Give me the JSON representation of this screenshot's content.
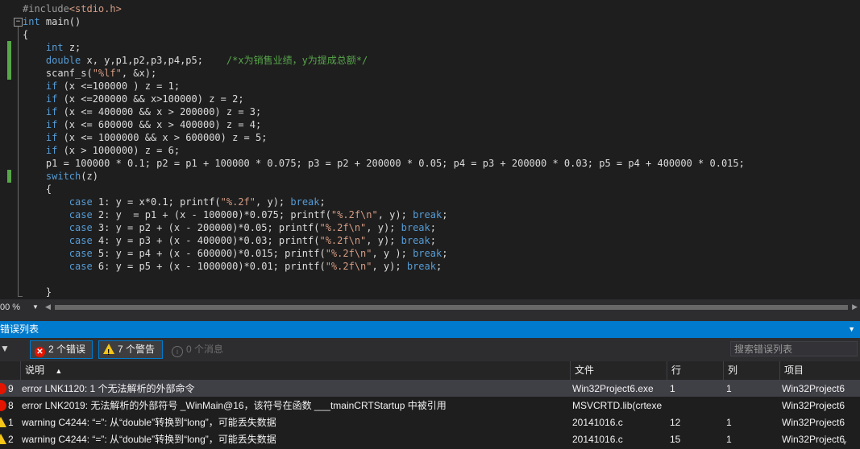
{
  "editor": {
    "lines": [
      [
        {
          "t": "#include",
          "c": "pp"
        },
        {
          "t": "<stdio.h>",
          "c": "hd"
        }
      ],
      [
        {
          "t": "int",
          "c": "kw"
        },
        {
          "t": " main()",
          "c": "tx"
        }
      ],
      [
        {
          "t": "{",
          "c": "tx"
        }
      ],
      [
        {
          "t": "    ",
          "c": "tx"
        },
        {
          "t": "int",
          "c": "kw"
        },
        {
          "t": " z;",
          "c": "tx"
        }
      ],
      [
        {
          "t": "    ",
          "c": "tx"
        },
        {
          "t": "double",
          "c": "kw"
        },
        {
          "t": " x, y,p1,p2,p3,p4,p5;    ",
          "c": "tx"
        },
        {
          "t": "/*x为销售业绩，y为提成总额*/",
          "c": "cm"
        }
      ],
      [
        {
          "t": "    scanf_s(",
          "c": "tx"
        },
        {
          "t": "\"%lf\"",
          "c": "str"
        },
        {
          "t": ", &x);",
          "c": "tx"
        }
      ],
      [
        {
          "t": "    ",
          "c": "tx"
        },
        {
          "t": "if",
          "c": "kw"
        },
        {
          "t": " (x <=100000 ) z = 1;",
          "c": "tx"
        }
      ],
      [
        {
          "t": "    ",
          "c": "tx"
        },
        {
          "t": "if",
          "c": "kw"
        },
        {
          "t": " (x <=200000 && x>100000) z = 2;",
          "c": "tx"
        }
      ],
      [
        {
          "t": "    ",
          "c": "tx"
        },
        {
          "t": "if",
          "c": "kw"
        },
        {
          "t": " (x <= 400000 && x > 200000) z = 3;",
          "c": "tx"
        }
      ],
      [
        {
          "t": "    ",
          "c": "tx"
        },
        {
          "t": "if",
          "c": "kw"
        },
        {
          "t": " (x <= 600000 && x > 400000) z = 4;",
          "c": "tx"
        }
      ],
      [
        {
          "t": "    ",
          "c": "tx"
        },
        {
          "t": "if",
          "c": "kw"
        },
        {
          "t": " (x <= 1000000 && x > 600000) z = 5;",
          "c": "tx"
        }
      ],
      [
        {
          "t": "    ",
          "c": "tx"
        },
        {
          "t": "if",
          "c": "kw"
        },
        {
          "t": " (x > 1000000) z = 6;",
          "c": "tx"
        }
      ],
      [
        {
          "t": "    p1 = 100000 * 0.1; p2 = p1 + 100000 * 0.075; p3 = p2 + 200000 * 0.05; p4 = p3 + 200000 * 0.03; p5 = p4 + 400000 * 0.015;",
          "c": "tx"
        }
      ],
      [
        {
          "t": "    ",
          "c": "tx"
        },
        {
          "t": "switch",
          "c": "kw"
        },
        {
          "t": "(z)",
          "c": "tx"
        }
      ],
      [
        {
          "t": "    {",
          "c": "tx"
        }
      ],
      [
        {
          "t": "        ",
          "c": "tx"
        },
        {
          "t": "case",
          "c": "kw"
        },
        {
          "t": " 1: y = x*0.1; printf(",
          "c": "tx"
        },
        {
          "t": "\"%.2f\"",
          "c": "str"
        },
        {
          "t": ", y); ",
          "c": "tx"
        },
        {
          "t": "break",
          "c": "kw"
        },
        {
          "t": ";",
          "c": "tx"
        }
      ],
      [
        {
          "t": "        ",
          "c": "tx"
        },
        {
          "t": "case",
          "c": "kw"
        },
        {
          "t": " 2: y  = p1 + (x - 100000)*0.075; printf(",
          "c": "tx"
        },
        {
          "t": "\"%.2f\\n\"",
          "c": "str"
        },
        {
          "t": ", y); ",
          "c": "tx"
        },
        {
          "t": "break",
          "c": "kw"
        },
        {
          "t": ";",
          "c": "tx"
        }
      ],
      [
        {
          "t": "        ",
          "c": "tx"
        },
        {
          "t": "case",
          "c": "kw"
        },
        {
          "t": " 3: y = p2 + (x - 200000)*0.05; printf(",
          "c": "tx"
        },
        {
          "t": "\"%.2f\\n\"",
          "c": "str"
        },
        {
          "t": ", y); ",
          "c": "tx"
        },
        {
          "t": "break",
          "c": "kw"
        },
        {
          "t": ";",
          "c": "tx"
        }
      ],
      [
        {
          "t": "        ",
          "c": "tx"
        },
        {
          "t": "case",
          "c": "kw"
        },
        {
          "t": " 4: y = p3 + (x - 400000)*0.03; printf(",
          "c": "tx"
        },
        {
          "t": "\"%.2f\\n\"",
          "c": "str"
        },
        {
          "t": ", y); ",
          "c": "tx"
        },
        {
          "t": "break",
          "c": "kw"
        },
        {
          "t": ";",
          "c": "tx"
        }
      ],
      [
        {
          "t": "        ",
          "c": "tx"
        },
        {
          "t": "case",
          "c": "kw"
        },
        {
          "t": " 5: y = p4 + (x - 600000)*0.015; printf(",
          "c": "tx"
        },
        {
          "t": "\"%.2f\\n\"",
          "c": "str"
        },
        {
          "t": ", y ); ",
          "c": "tx"
        },
        {
          "t": "break",
          "c": "kw"
        },
        {
          "t": ";",
          "c": "tx"
        }
      ],
      [
        {
          "t": "        ",
          "c": "tx"
        },
        {
          "t": "case",
          "c": "kw"
        },
        {
          "t": " 6: y = p5 + (x - 1000000)*0.01; printf(",
          "c": "tx"
        },
        {
          "t": "\"%.2f\\n\"",
          "c": "str"
        },
        {
          "t": ", y); ",
          "c": "tx"
        },
        {
          "t": "break",
          "c": "kw"
        },
        {
          "t": ";",
          "c": "tx"
        }
      ],
      [
        {
          "t": "",
          "c": "tx"
        }
      ],
      [
        {
          "t": "    }",
          "c": "tx"
        }
      ]
    ],
    "fold_glyph": "−",
    "zoom_label": "00 %",
    "zoom_arrow": "▼",
    "scroll_left": "◀",
    "scroll_right": "▶"
  },
  "error_list": {
    "title": "错误列表",
    "menu_glyph": "▼",
    "filter_glyph": "▼",
    "errors_button": "2 个错误",
    "warnings_button": "7 个警告",
    "messages_button": "0 个消息",
    "search_placeholder": "搜索错误列表",
    "columns": {
      "desc": "说明",
      "sort": "▲",
      "file": "文件",
      "line": "行",
      "col": "列",
      "project": "项目"
    },
    "rows": [
      {
        "type": "error",
        "num": "9",
        "desc": "error LNK1120: 1 个无法解析的外部命令",
        "file": "Win32Project6.exe",
        "line": "1",
        "col": "1",
        "project": "Win32Project6"
      },
      {
        "type": "error",
        "num": "8",
        "desc": "error LNK2019: 无法解析的外部符号 _WinMain@16，该符号在函数 ___tmainCRTStartup 中被引用",
        "file": "MSVCRTD.lib(crtexe",
        "line": "",
        "col": "",
        "project": "Win32Project6"
      },
      {
        "type": "warning",
        "num": "1",
        "desc": "warning C4244: “=”: 从“double”转换到“long”，可能丢失数据",
        "file": "20141016.c",
        "line": "12",
        "col": "1",
        "project": "Win32Project6"
      },
      {
        "type": "warning",
        "num": "2",
        "desc": "warning C4244: “=”: 从“double”转换到“long”，可能丢失数据",
        "file": "20141016.c",
        "line": "15",
        "col": "1",
        "project": "Win32Project6"
      }
    ]
  },
  "colors": {
    "error": "#e51400",
    "warning": "#f5c518",
    "accent": "#007acc",
    "keyword": "#569cd6",
    "comment": "#57a64a",
    "string": "#d69d85"
  }
}
